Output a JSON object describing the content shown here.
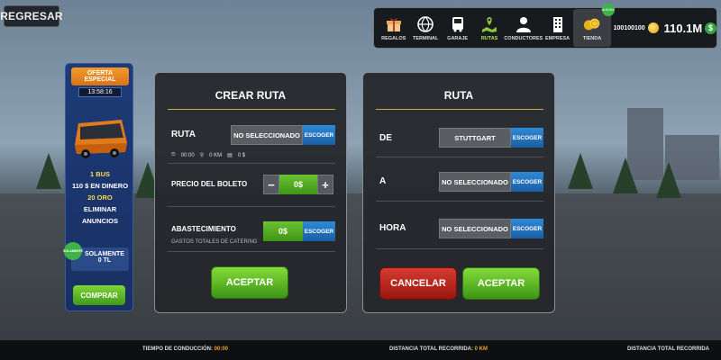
{
  "header": {
    "back_label": "REGRESAR"
  },
  "nav": {
    "items": [
      {
        "label": "REGALOS",
        "icon": "gift-icon"
      },
      {
        "label": "TERMINAL",
        "icon": "terminal-globe-icon"
      },
      {
        "label": "GARAJE",
        "icon": "bus-icon"
      },
      {
        "label": "RUTAS",
        "icon": "map-icon"
      },
      {
        "label": "CONDUCTORES",
        "icon": "driver-icon"
      },
      {
        "label": "EMPRESA",
        "icon": "building-icon"
      },
      {
        "label": "TIENDA",
        "icon": "coins-icon"
      }
    ],
    "active": "RUTAS",
    "store_badge": "NUEVAS",
    "coins": "100100100",
    "money": "110.1M"
  },
  "offer": {
    "title": "OFERTA ESPECIAL",
    "timer": "13:58:16",
    "lines": [
      "1 BUS",
      "110 $ EN DINERO",
      "20 ORO",
      "ELIMINAR",
      "ANUNCIOS"
    ],
    "solo_badge": "SOLAMENTE",
    "solo_label": "SOLAMENTE",
    "price": "0 TL",
    "buy_label": "COMPRAR"
  },
  "create_route": {
    "title": "CREAR RUTA",
    "route_label": "RUTA",
    "route_value": "NO SELECCIONADO",
    "choose_label": "ESCOGER",
    "meta_time": "00:00",
    "meta_km": "0 KM",
    "meta_money": "0 $",
    "ticket_label": "PRECIO DEL BOLETO",
    "ticket_value": "0$",
    "minus": "−",
    "plus": "+",
    "supply_label": "ABASTECIMIENTO",
    "supply_sub": "GASTOS TOTALES DE CATERING",
    "supply_value": "0$",
    "accept_label": "ACEPTAR"
  },
  "route": {
    "title": "RUTA",
    "from_label": "DE",
    "from_value": "STUTTGART",
    "to_label": "A",
    "to_value": "NO SELECCIONADO",
    "time_label": "HORA",
    "time_value": "NO SELECCIONADO",
    "choose_label": "ESCOGER",
    "cancel_label": "CANCELAR",
    "accept_label": "ACEPTAR"
  },
  "bottom": {
    "drive_time_label": "TIEMPO DE CONDUCCIÓN:",
    "drive_time_value": "00:00",
    "total_distance_label": "DISTANCIA TOTAL RECORRIDA:",
    "total_distance_value": "0 KM",
    "total_distance_label_2": "DISTANCIA TOTAL RECORRIDA"
  },
  "colors": {
    "accent_blue": "#1f6fc0",
    "accent_green": "#4fad1f",
    "cancel_red": "#c2281f",
    "offer_orange": "#f39a2b"
  }
}
